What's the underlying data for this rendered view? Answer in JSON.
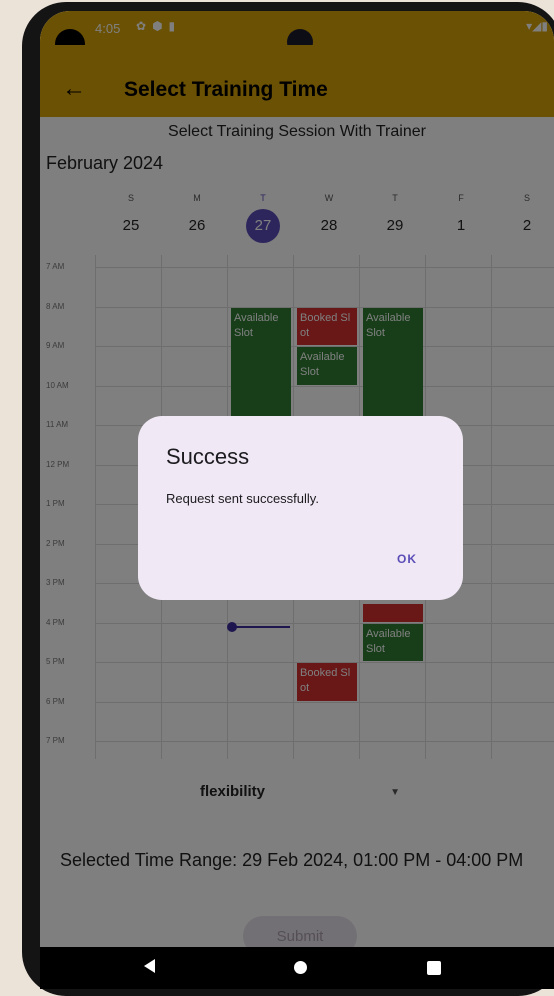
{
  "status_bar": {
    "time": "4:05"
  },
  "app_bar": {
    "title": "Select Training Time",
    "back_icon": "arrow-left-icon"
  },
  "calendar": {
    "subtitle": "Select Training Session With Trainer",
    "month_label": "February 2024",
    "days": [
      {
        "dow": "S",
        "num": "25",
        "selected": false
      },
      {
        "dow": "M",
        "num": "26",
        "selected": false
      },
      {
        "dow": "T",
        "num": "27",
        "selected": true
      },
      {
        "dow": "W",
        "num": "28",
        "selected": false
      },
      {
        "dow": "T",
        "num": "29",
        "selected": false
      },
      {
        "dow": "F",
        "num": "1",
        "selected": false
      },
      {
        "dow": "S",
        "num": "2",
        "selected": false
      }
    ],
    "hours": [
      "7 AM",
      "8 AM",
      "9 AM",
      "10 AM",
      "11 AM",
      "12 PM",
      "1 PM",
      "2 PM",
      "3 PM",
      "4 PM",
      "5 PM",
      "6 PM",
      "7 PM"
    ],
    "slots": [
      {
        "label": "Available Slot",
        "status": "available",
        "day_index": 2,
        "start": "8 AM",
        "end": "11 AM"
      },
      {
        "label": "Booked Slot",
        "status": "booked",
        "day_index": 3,
        "start": "8 AM",
        "end": "9 AM"
      },
      {
        "label": "Available Slot",
        "status": "available",
        "day_index": 3,
        "start": "9 AM",
        "end": "10 AM"
      },
      {
        "label": "Available Slot",
        "status": "available",
        "day_index": 4,
        "start": "8 AM",
        "end": "11 AM"
      },
      {
        "label": "",
        "status": "booked",
        "day_index": 4,
        "start": "3:30 PM",
        "end": "4 PM"
      },
      {
        "label": "Available Slot",
        "status": "available",
        "day_index": 4,
        "start": "4 PM",
        "end": "5 PM"
      },
      {
        "label": "Booked Slot",
        "status": "booked",
        "day_index": 3,
        "start": "5 PM",
        "end": "6 PM"
      }
    ]
  },
  "flexibility": {
    "label": "flexibility"
  },
  "selected_range": {
    "text": "Selected Time Range: 29 Feb 2024, 01:00 PM - 04:00 PM"
  },
  "submit": {
    "label": "Submit"
  },
  "dialog": {
    "title": "Success",
    "message": "Request sent successfully.",
    "ok_label": "OK"
  },
  "colors": {
    "app_bar": "#d6a206",
    "available": "#2e7d32",
    "booked": "#d32f2f",
    "accent": "#5b4db8"
  }
}
